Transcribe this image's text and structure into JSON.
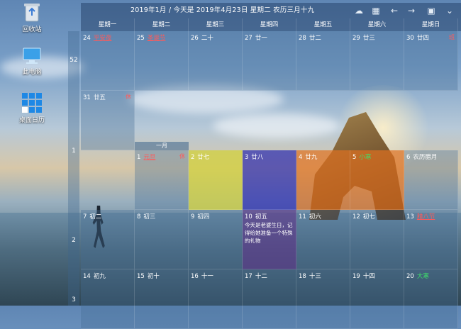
{
  "desktop": {
    "icons": [
      {
        "label": "回收站",
        "icon": "recycle-bin-icon"
      },
      {
        "label": "此电脑",
        "icon": "computer-icon"
      },
      {
        "label": "桌面日历",
        "icon": "desktop-calendar-icon"
      }
    ]
  },
  "calendar": {
    "title": "2019年1月 / 今天是 2019年4月23日 星期二 农历三月十九",
    "toolbar": [
      "cloud-icon",
      "calendar-icon",
      "arrow-left-icon",
      "arrow-right-icon",
      "display-icon",
      "chevron-down-icon"
    ],
    "weekdays": [
      "星期一",
      "星期二",
      "星期三",
      "星期四",
      "星期五",
      "星期六",
      "星期日"
    ],
    "week_numbers": [
      "52",
      "1",
      "2",
      "3"
    ],
    "month_label": "一月",
    "colors": {
      "red": "#ff5a5a",
      "green": "#3ee06a",
      "yellow": "#d2d23c",
      "blue": "#2a2ab0",
      "orange": "#e07020",
      "purple": "#5a3a8a"
    },
    "rows": [
      [
        {
          "day": "24",
          "lunar": "平安夜",
          "style": "red"
        },
        {
          "day": "25",
          "lunar": "圣诞节",
          "style": "red"
        },
        {
          "day": "26",
          "lunar": "二十"
        },
        {
          "day": "27",
          "lunar": "廿一"
        },
        {
          "day": "28",
          "lunar": "廿二"
        },
        {
          "day": "29",
          "lunar": "廿三"
        },
        {
          "day": "30",
          "lunar": "廿四",
          "tag": "班"
        }
      ],
      [
        {
          "day": "31",
          "lunar": "廿五",
          "tag": "休"
        }
      ],
      [
        {
          "day": "1",
          "lunar": "元旦",
          "style": "red",
          "tag": "休"
        },
        {
          "day": "2",
          "lunar": "廿七",
          "color": "yellow"
        },
        {
          "day": "3",
          "lunar": "廿八",
          "color": "blue"
        },
        {
          "day": "4",
          "lunar": "廿九",
          "color": "orange"
        },
        {
          "day": "5",
          "lunar": "小寒",
          "style": "grn",
          "color": "orange"
        },
        {
          "day": "6",
          "lunar": "农历腊月"
        }
      ],
      [
        {
          "day": "7",
          "lunar": "初二"
        },
        {
          "day": "8",
          "lunar": "初三"
        },
        {
          "day": "9",
          "lunar": "初四"
        },
        {
          "day": "10",
          "lunar": "初五",
          "color": "purple",
          "note": "今天是老婆生日，记得给她准备一个特殊的礼物"
        },
        {
          "day": "11",
          "lunar": "初六"
        },
        {
          "day": "12",
          "lunar": "初七"
        },
        {
          "day": "13",
          "lunar": "腊八节",
          "style": "red"
        }
      ],
      [
        {
          "day": "14",
          "lunar": "初九"
        },
        {
          "day": "15",
          "lunar": "初十"
        },
        {
          "day": "16",
          "lunar": "十一"
        },
        {
          "day": "17",
          "lunar": "十二"
        },
        {
          "day": "18",
          "lunar": "十三"
        },
        {
          "day": "19",
          "lunar": "十四"
        },
        {
          "day": "20",
          "lunar": "大寒",
          "style": "grn"
        }
      ]
    ]
  }
}
